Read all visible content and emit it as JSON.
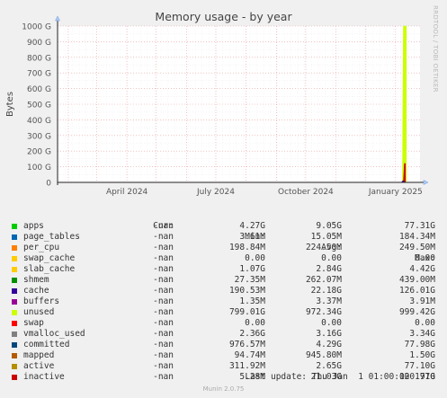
{
  "chart_data": {
    "type": "area",
    "title": "Memory usage - by year",
    "ylabel": "Bytes",
    "side_label": "RRDTOOL / TOBI OETIKER",
    "y_ticks": [
      "0",
      "100 G",
      "200 G",
      "300 G",
      "400 G",
      "500 G",
      "600 G",
      "700 G",
      "800 G",
      "900 G",
      "1000 G"
    ],
    "ylim_gb": [
      0,
      1000
    ],
    "x_ticks": [
      {
        "label": "April 2024",
        "date": "2024-04-01"
      },
      {
        "label": "July 2024",
        "date": "2024-07-01"
      },
      {
        "label": "October 2024",
        "date": "2024-10-01"
      },
      {
        "label": "January 2025",
        "date": "2025-01-01"
      }
    ],
    "x_range": [
      "2024-01-21",
      "2025-01-26"
    ],
    "grid": true,
    "series_plot": [
      {
        "name": "unused",
        "color": "#CCFF00",
        "points": [
          [
            "2025-01-08",
            0
          ],
          [
            "2025-01-09",
            999.42
          ],
          [
            "2025-01-12",
            999.42
          ],
          [
            "2025-01-12",
            0
          ]
        ]
      },
      {
        "name": "inactive",
        "color": "#CC0000",
        "points": [
          [
            "2025-01-09",
            0
          ],
          [
            "2025-01-10",
            120.71
          ],
          [
            "2025-01-11",
            120.71
          ],
          [
            "2025-01-11",
            0
          ]
        ]
      },
      {
        "name": "cache",
        "color": "#330099",
        "points": [
          [
            "2025-01-07",
            0
          ],
          [
            "2025-01-08",
            8
          ],
          [
            "2025-01-09",
            10
          ],
          [
            "2025-01-10",
            4
          ],
          [
            "2025-01-10",
            0
          ]
        ]
      }
    ]
  },
  "legend": {
    "headers": {
      "cur": "Cur:",
      "min": "Min:",
      "avg": "Avg:",
      "max": "Max:"
    },
    "rows": [
      {
        "name": "apps",
        "color": "#00CC00",
        "cur": "-nan",
        "min": "4.27G",
        "avg": "9.05G",
        "max": "77.31G"
      },
      {
        "name": "page_tables",
        "color": "#0066B3",
        "cur": "-nan",
        "min": "3.61M",
        "avg": "15.05M",
        "max": "184.34M"
      },
      {
        "name": "per_cpu",
        "color": "#FF8000",
        "cur": "-nan",
        "min": "198.84M",
        "avg": "224.50M",
        "max": "249.50M"
      },
      {
        "name": "swap_cache",
        "color": "#FFCC00",
        "cur": "-nan",
        "min": "0.00",
        "avg": "0.00",
        "max": "0.00"
      },
      {
        "name": "slab_cache",
        "color": "#FFCC00",
        "cur": "-nan",
        "min": "1.07G",
        "avg": "2.84G",
        "max": "4.42G"
      },
      {
        "name": "shmem",
        "color": "#008F00",
        "cur": "-nan",
        "min": "27.35M",
        "avg": "262.07M",
        "max": "439.00M"
      },
      {
        "name": "cache",
        "color": "#330099",
        "cur": "-nan",
        "min": "190.53M",
        "avg": "22.18G",
        "max": "126.01G"
      },
      {
        "name": "buffers",
        "color": "#990099",
        "cur": "-nan",
        "min": "1.35M",
        "avg": "3.37M",
        "max": "3.91M"
      },
      {
        "name": "unused",
        "color": "#CCFF00",
        "cur": "-nan",
        "min": "799.01G",
        "avg": "972.34G",
        "max": "999.42G"
      },
      {
        "name": "swap",
        "color": "#FF0000",
        "cur": "-nan",
        "min": "0.00",
        "avg": "0.00",
        "max": "0.00"
      },
      {
        "name": "vmalloc_used",
        "color": "#808080",
        "cur": "-nan",
        "min": "2.36G",
        "avg": "3.16G",
        "max": "3.34G"
      },
      {
        "name": "committed",
        "color": "#00487D",
        "cur": "-nan",
        "min": "976.57M",
        "avg": "4.29G",
        "max": "77.98G"
      },
      {
        "name": "mapped",
        "color": "#B35A00",
        "cur": "-nan",
        "min": "94.74M",
        "avg": "945.80M",
        "max": "1.50G"
      },
      {
        "name": "active",
        "color": "#B38F00",
        "cur": "-nan",
        "min": "311.92M",
        "avg": "2.65G",
        "max": "77.10G"
      },
      {
        "name": "inactive",
        "color": "#CC0000",
        "cur": "-nan",
        "min": "5.28M",
        "avg": "21.03G",
        "max": "120.71G"
      }
    ]
  },
  "footer": {
    "last_update": "Last update: Thu Jan  1 01:00:00 1970",
    "munin": "Munin 2.0.75"
  }
}
